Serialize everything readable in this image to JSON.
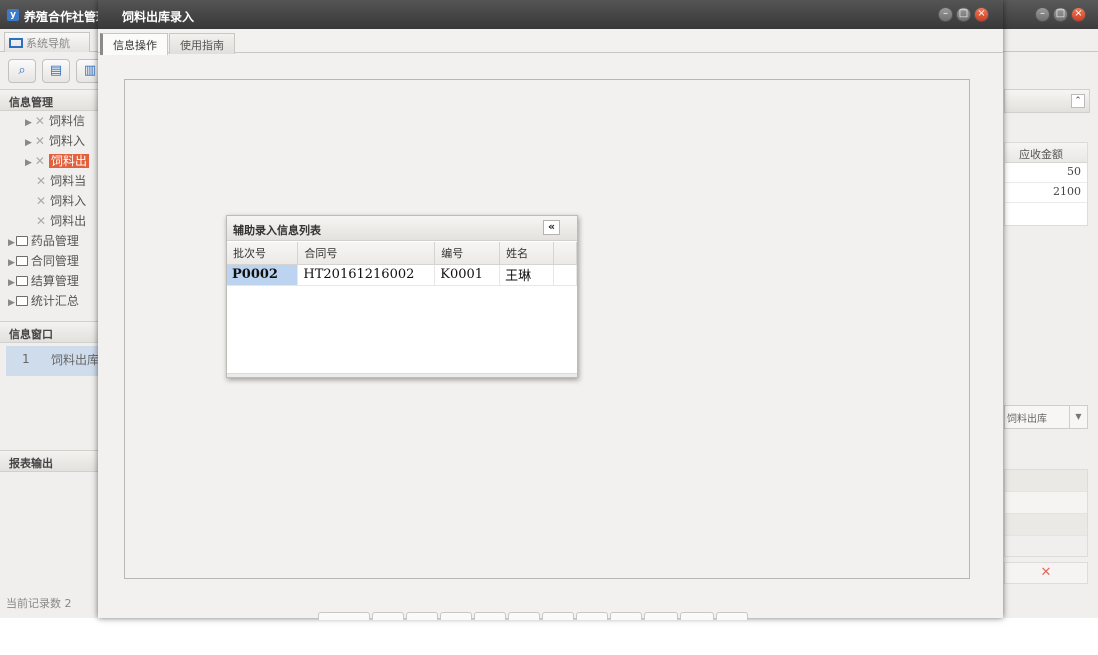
{
  "background_window": {
    "app_title": "养殖合作社管理",
    "logo": "y",
    "nav_tab": "系统导航",
    "sections": {
      "info_manage": "信息管理",
      "info_window": "信息窗口",
      "report_output": "报表输出"
    },
    "tree_items": [
      {
        "label": "饲料信",
        "type": "leaf-arrow"
      },
      {
        "label": "饲料入",
        "type": "leaf-arrow"
      },
      {
        "label": "饲料出",
        "type": "leaf-arrow-selected"
      },
      {
        "label": "饲料当",
        "type": "leaf"
      },
      {
        "label": "饲料入",
        "type": "leaf"
      },
      {
        "label": "饲料出",
        "type": "leaf"
      },
      {
        "label": "药品管理",
        "type": "folder"
      },
      {
        "label": "合同管理",
        "type": "folder"
      },
      {
        "label": "结算管理",
        "type": "folder"
      },
      {
        "label": "统计汇总",
        "type": "folder"
      }
    ],
    "window_list": [
      {
        "index": "1",
        "label": "饲料出库"
      }
    ],
    "status": "当前记录数 2",
    "grid": {
      "header": "应收金额",
      "values": [
        "50",
        "2100"
      ]
    },
    "select_value": "饲料出库"
  },
  "dialog": {
    "title": "饲料出库录入",
    "tabs": [
      {
        "label": "信息操作",
        "active": true
      },
      {
        "label": "使用指南",
        "active": false
      }
    ]
  },
  "popup": {
    "title": "辅助录入信息列表",
    "collapse_glyph": "«",
    "columns": [
      "批次号",
      "合同号",
      "编号",
      "姓名"
    ],
    "rows": [
      [
        "P0002",
        "HT20161216002",
        "K0001",
        "王琳"
      ]
    ]
  }
}
